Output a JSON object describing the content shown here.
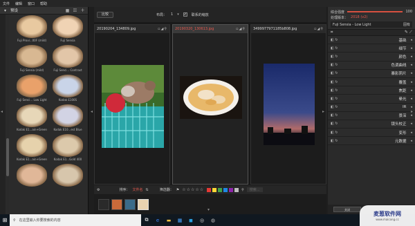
{
  "menu": [
    "文件",
    "编辑",
    "窗口",
    "帮助"
  ],
  "left": {
    "title": "预设",
    "presets": [
      {
        "label": "Fuji Provi...00F (mild)",
        "color": "#e8c9a0"
      },
      {
        "label": "Fuji Sensia",
        "color": "#f0d3b4"
      },
      {
        "label": "Fuji Sensia (mild)",
        "color": "#d8b892"
      },
      {
        "label": "Fuji Senci... Contrast",
        "color": "#e2c6a8"
      },
      {
        "label": "Fuji Senci... Low Light",
        "color": "#e9a16a"
      },
      {
        "label": "Kodak E100S",
        "color": "#c9d4e8"
      },
      {
        "label": "Kodak E1...ain+Green",
        "color": "#e7d7b8"
      },
      {
        "label": "Kodak E10...est Blue",
        "color": "#d2d3e4"
      },
      {
        "label": "Kodak E1...ain+Green",
        "color": "#e6d2ac"
      },
      {
        "label": "Kodak E1...Gold 400",
        "color": "#dcc9ab"
      },
      {
        "label": "",
        "color": "#e0b798"
      },
      {
        "label": "",
        "color": "#d7c6ac"
      }
    ]
  },
  "toolbar": {
    "compare_label": "比较",
    "layout_label": "布局：",
    "layout_value": "1",
    "linked_label": "联系的缩放",
    "linked_checked": "✓"
  },
  "columns": [
    {
      "filename": "20190204_134809.jpg",
      "active": false
    },
    {
      "filename": "20190320_130613.jpg",
      "active": true
    },
    {
      "filename": "3499977971185b808.jpg",
      "active": false
    }
  ],
  "bottombar": {
    "sort_label": "排序：",
    "sort_value": "文件名",
    "filter_label": "筛选器：",
    "stars": "☆☆☆☆☆",
    "colors": [
      "#e53935",
      "#fdd835",
      "#43a047",
      "#1e88e5",
      "#8e24aa",
      "#bdbdbd"
    ],
    "search_placeholder": "搜索..."
  },
  "right": {
    "strength_label": "综合强度",
    "strength_value": "100",
    "strength_fraction": 1.0,
    "process_label": "处理版本：",
    "process_value": "2018 (v2)",
    "preset_name": "Fuji Sensia - Low Light",
    "preset_tag": "固有",
    "modules": [
      "基础",
      "细节",
      "颜色",
      "色调曲线",
      "暴影阴片",
      "覆盖",
      "焦距",
      "晕光",
      "IR",
      "景深",
      "镜头校正",
      "变形",
      "元数据"
    ],
    "bottom_button": "关闭"
  },
  "taskbar": {
    "search_placeholder": "在这里输入你要搜索的内容"
  },
  "watermark": {
    "title": "麦葱软件网",
    "sub": "www.maicong.cc"
  }
}
